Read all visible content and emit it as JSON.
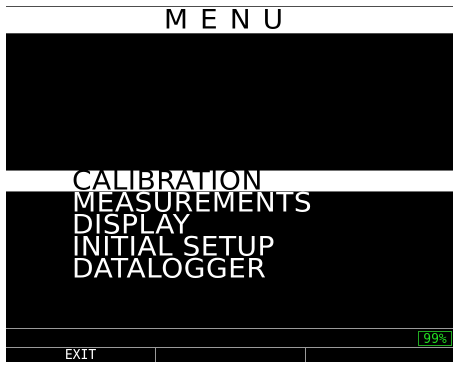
{
  "header": {
    "title": "MENU"
  },
  "menu": {
    "items": [
      {
        "label": "CALIBRATION",
        "selected": true
      },
      {
        "label": "MEASUREMENTS",
        "selected": false
      },
      {
        "label": "DISPLAY",
        "selected": false
      },
      {
        "label": "INITIAL SETUP",
        "selected": false
      },
      {
        "label": "DATALOGGER",
        "selected": false
      }
    ]
  },
  "status": {
    "battery": "99%"
  },
  "softkeys": {
    "left": "EXIT",
    "middle": "",
    "right": ""
  },
  "colors": {
    "background": "#000000",
    "highlight": "#ffffff",
    "battery": "#22dd22"
  }
}
